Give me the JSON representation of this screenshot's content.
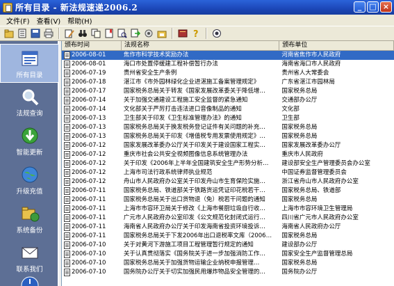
{
  "window": {
    "title": "所有目录 - 新法规速递2006.2"
  },
  "menubar": {
    "items": [
      "文件(F)",
      "查看(V)",
      "帮助(H)"
    ]
  },
  "sidebar": {
    "items": [
      {
        "label": "所有目录",
        "icon": "folder-icon",
        "active": true
      },
      {
        "label": "法规查询",
        "icon": "magnifier-icon"
      },
      {
        "label": "智能更新",
        "icon": "update-icon"
      },
      {
        "label": "升级充值",
        "icon": "globe-icon"
      },
      {
        "label": "系统备份",
        "icon": "backup-icon"
      },
      {
        "label": "联系我们",
        "icon": "mail-icon"
      }
    ]
  },
  "list": {
    "columns": [
      "颁布时间",
      "法规名称",
      "颁布单位"
    ],
    "rows": [
      [
        "2006-08-01",
        "焦作市科学技术奖励办法",
        "河南省焦作市人民政府"
      ],
      [
        "2006-08-01",
        "海口市处置停缓建工程补偿暂行办法",
        "海南省海口市人民政府"
      ],
      [
        "2006-07-19",
        "贵州省安全生产条例",
        "贵州省人大常委会"
      ],
      [
        "2006-07-18",
        "湛江市《市外园林绿化企业进湛施工备案管理规定》",
        "广东省湛江市园林局"
      ],
      [
        "2006-07-17",
        "国家税务总局关于转发《国家发展改革委关于降低增…",
        "国家税务总局"
      ],
      [
        "2006-07-14",
        "关于加强交通建设工程施工安全监督的紧急通知",
        "交通部办公厅"
      ],
      [
        "2006-07-14",
        "文化部关于严厉打击违法进口音像制品的通知",
        "文化部"
      ],
      [
        "2006-07-13",
        "卫生部关于印发《卫生标准管理办法》的通知",
        "卫生部"
      ],
      [
        "2006-07-13",
        "国家税务总局关于换发税务登记证件有关问题的补充…",
        "国家税务总局"
      ],
      [
        "2006-07-13",
        "国家税务总局关于印发《增值税专用发票使用规定》…",
        "国家税务总局"
      ],
      [
        "2006-07-12",
        "国家发展改革委办公厅关于印发关于建设国家工程实…",
        "国家发展改革委办公厅"
      ],
      [
        "2006-07-12",
        "重庆市社会公共安全视频图像信息系统管理办法",
        "重庆市人民政府"
      ],
      [
        "2006-07-12",
        "关于印发《2006年上半年全国建筑安全生产形势分析…",
        "建设部安全生产管理委员会办公室"
      ],
      [
        "2006-07-12",
        "上海市司法行政系统律师执业规范",
        "中国证券监督管理委员会"
      ],
      [
        "2006-07-12",
        "舟山市人民政府办公室关于印发舟山市生育保险实施…",
        "浙江省舟山市人民政府办公室"
      ],
      [
        "2006-07-11",
        "国家税务总局、铁道部关于铁路货运凭证印花税若干…",
        "国家税务总局、铁道部"
      ],
      [
        "2006-07-11",
        "国家税务总局关于出口货物退（免）税若干问题的通知",
        "国家税务总局"
      ],
      [
        "2006-07-11",
        "上海市市容环卫局关于修改《上海市餐厨垃圾自行收…",
        "上海市市容环境卫生管理局"
      ],
      [
        "2006-07-11",
        "广元市人民政府办公室印发《公文规范化封闭式运行…",
        "四川省广元市人民政府办公室"
      ],
      [
        "2006-07-11",
        "海南省人民政府办公厅关于印发海南省投资环境投诉…",
        "海南省人民政府办公厅"
      ],
      [
        "2006-07-11",
        "国家税务总局关于下发2006年出口退税率文库（2006…",
        "国家税务总局"
      ],
      [
        "2006-07-10",
        "关于对黄河下游施工项目工程管理暂行规定的通知",
        "建设部办公厅"
      ],
      [
        "2006-07-10",
        "关于认真贯彻落实《国务院关于进一步加强消防工作…",
        "国家安全生产监督管理总局"
      ],
      [
        "2006-07-10",
        "国家税务总局关于加强货物运输企业纳税申报管理…",
        "国家税务总局"
      ],
      [
        "2006-07-10",
        "国务院办公厅关于切实加强民用爆炸物品安全管理的…",
        "国务院办公厅"
      ]
    ]
  }
}
